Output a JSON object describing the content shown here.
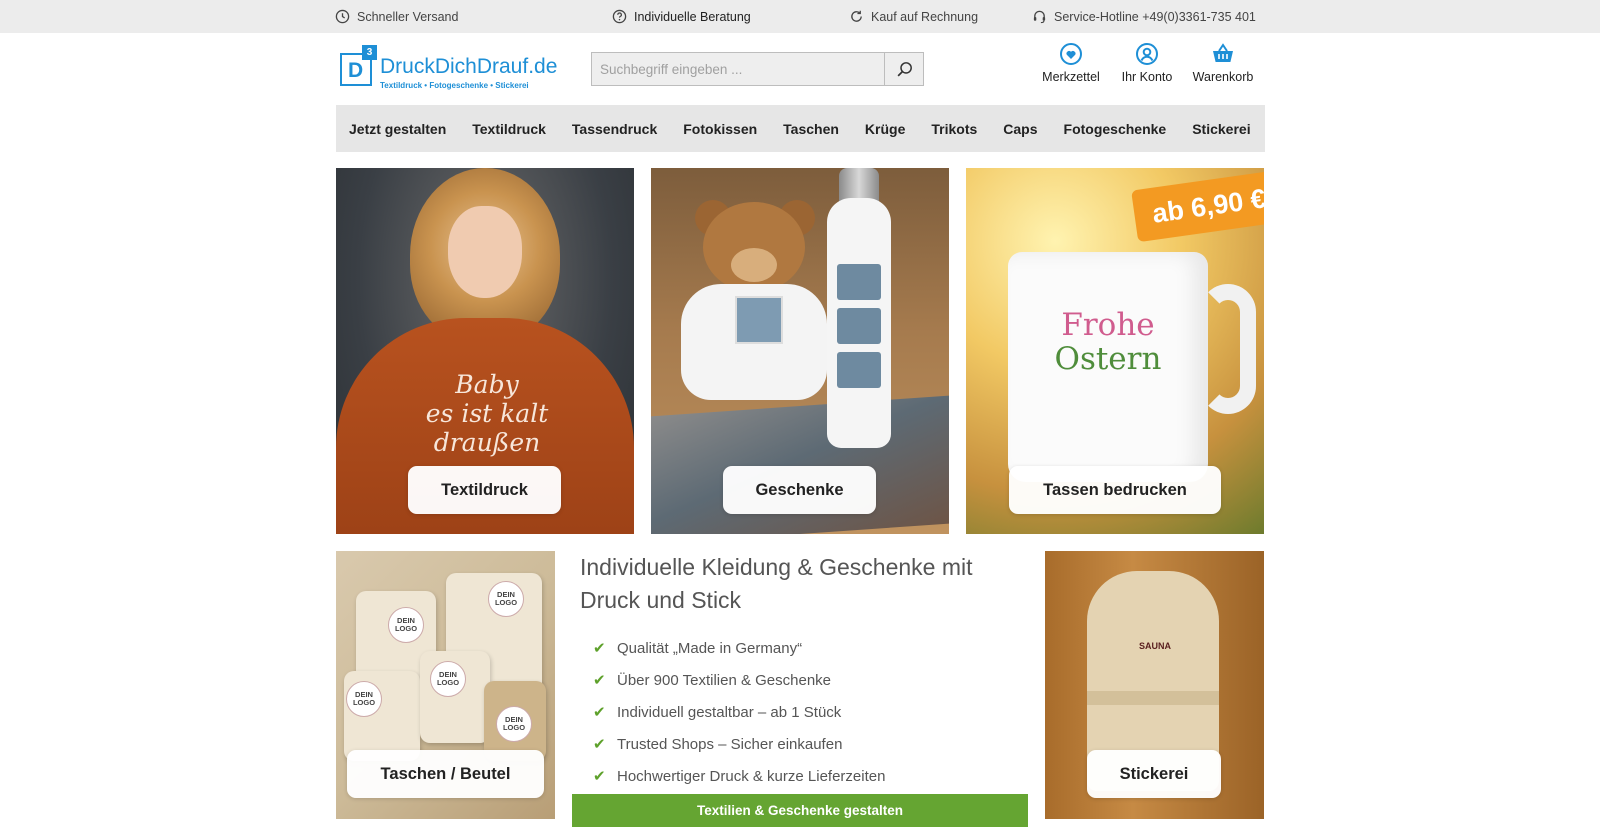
{
  "topbar": {
    "items": [
      {
        "label": "Schneller Versand",
        "icon": "clock-icon"
      },
      {
        "label": "Individuelle Beratung",
        "icon": "question-circle-icon"
      },
      {
        "label": "Kauf auf Rechnung",
        "icon": "refresh-icon"
      },
      {
        "label": "Service-Hotline +49(0)3361-735 401",
        "icon": "headset-icon"
      }
    ]
  },
  "logo": {
    "name": "DruckDichDrauf.de",
    "tagline": "Textildruck • Fotogeschenke • Stickerei",
    "box_letter": "D",
    "superscript": "3"
  },
  "search": {
    "placeholder": "Suchbegriff eingeben ...",
    "icon": "search-icon"
  },
  "header_actions": [
    {
      "label": "Merkzettel",
      "icon": "heart-icon"
    },
    {
      "label": "Ihr Konto",
      "icon": "user-icon"
    },
    {
      "label": "Warenkorb",
      "icon": "basket-icon"
    }
  ],
  "nav": {
    "items": [
      "Jetzt gestalten",
      "Textildruck",
      "Tassendruck",
      "Fotokissen",
      "Taschen",
      "Krüge",
      "Trikots",
      "Caps",
      "Fotogeschenke",
      "Stickerei"
    ]
  },
  "tiles": {
    "textildruck": {
      "label": "Textildruck",
      "image_text": [
        "Baby",
        "es ist kalt",
        "draußen"
      ]
    },
    "geschenke": {
      "label": "Geschenke"
    },
    "tassen": {
      "label": "Tassen bedrucken",
      "price_badge": "ab 6,90 €",
      "mug_text": [
        "Frohe",
        "Ostern"
      ]
    },
    "taschen": {
      "label": "Taschen / Beutel",
      "logo_badge": "DEIN LOGO"
    },
    "stickerei": {
      "label": "Stickerei",
      "embroidery_text": "SAUNA"
    }
  },
  "intro": {
    "title": "Individuelle Kleidung & Geschenke mit Druck und Stick",
    "usps": [
      "Qualität „Made in Germany“",
      "Über 900 Textilien & Geschenke",
      "Individuell gestaltbar – ab 1 Stück",
      "Trusted Shops – Sicher einkaufen",
      "Hochwertiger Druck & kurze Lieferzeiten"
    ],
    "check_icon": "✔",
    "cta_label": "Textilien & Geschenke gestalten"
  },
  "colors": {
    "brand_blue": "#1e8fd6",
    "cta_green": "#65a532",
    "check_green": "#5ea12b",
    "price_orange": "#f39a22",
    "topbar_bg": "#ececec",
    "nav_bg": "#e6e6e6"
  }
}
